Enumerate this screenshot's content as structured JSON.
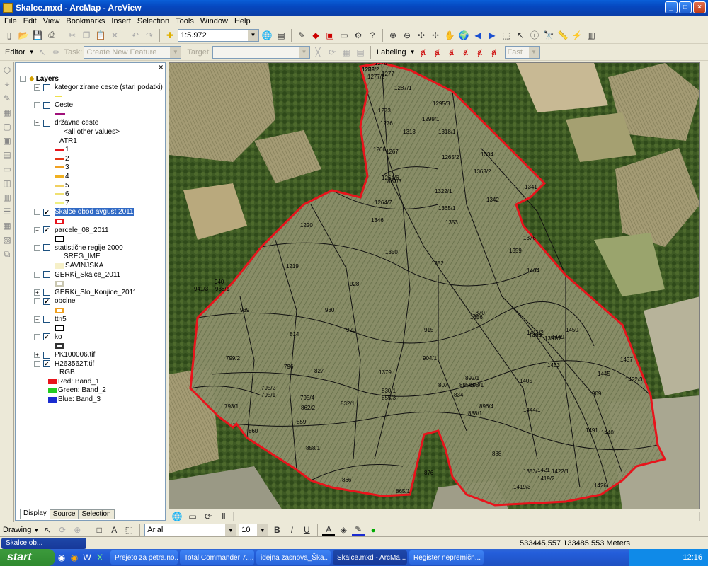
{
  "window": {
    "title": "Skalce.mxd - ArcMap - ArcView"
  },
  "menu": [
    "File",
    "Edit",
    "View",
    "Bookmarks",
    "Insert",
    "Selection",
    "Tools",
    "Window",
    "Help"
  ],
  "toolbar1": {
    "scale": "1:5.972"
  },
  "editor": {
    "label": "Editor",
    "task_label": "Task:",
    "task_value": "Create New Feature",
    "target_label": "Target:",
    "labeling_label": "Labeling",
    "fast_value": "Fast"
  },
  "toc": {
    "root": "Layers",
    "layers": [
      {
        "name": "kategorizirane ceste (stari podatki)",
        "checked": false
      },
      {
        "name": "Ceste",
        "checked": false
      },
      {
        "name": "državne ceste",
        "checked": false,
        "sub_all": "<all other values>",
        "sub_field": "ATR1",
        "classes": [
          "1",
          "2",
          "3",
          "4",
          "5",
          "6",
          "7"
        ]
      },
      {
        "name": "Skalce obod avgust 2011",
        "checked": true
      },
      {
        "name": "parcele_08_2011",
        "checked": true
      },
      {
        "name": "statistične regije 2000",
        "checked": false,
        "sub_field": "SREG_IME",
        "sub_value": "SAVINJSKA"
      },
      {
        "name": "GERKi_Skalce_2011",
        "checked": false
      },
      {
        "name": "GERKi_Slo_Konjice_2011",
        "checked": false
      },
      {
        "name": "obcine",
        "checked": true
      },
      {
        "name": "ttn5",
        "checked": false
      },
      {
        "name": "ko",
        "checked": true
      },
      {
        "name": "PK100006.tif",
        "checked": false
      },
      {
        "name": "H263562T.tif",
        "checked": true,
        "sub_field": "RGB",
        "bands": [
          "Red:   Band_1",
          "Green: Band_2",
          "Blue:  Band_3"
        ]
      }
    ],
    "tabs": [
      "Display",
      "Source",
      "Selection"
    ]
  },
  "map": {
    "parcels": [
      "1272",
      "1278",
      "1277/2",
      "1277",
      "1287/1",
      "1295/3",
      "1273",
      "1276",
      "1299/1",
      "1313",
      "1318/1",
      "1267",
      "1266",
      "1265/2",
      "1334",
      "1363/2",
      "1264/6",
      "1342",
      "1341",
      "1322/1",
      "1346",
      "1220",
      "1353",
      "1365/1",
      "1350",
      "1219",
      "1352",
      "1376",
      "1359",
      "1464",
      "928",
      "930",
      "939",
      "920",
      "915",
      "1370",
      "1356",
      "1454",
      "1450",
      "1449",
      "1445",
      "909",
      "1379",
      "1405",
      "1440",
      "1426",
      "1419/3",
      "1419/2",
      "1421",
      "1422/1",
      "888",
      "876",
      "866",
      "865/1",
      "858/1",
      "859",
      "860",
      "832/1",
      "796",
      "795/2",
      "795/1",
      "795/4",
      "793/1",
      "799/2",
      "827",
      "814",
      "1357/2",
      "1411/2",
      "1444/1",
      "1491",
      "1453",
      "1437",
      "1422/3",
      "1353/1",
      "940",
      "938/1",
      "941/3",
      "904/1",
      "892/1",
      "898/1",
      "896/4",
      "834",
      "830/1",
      "855/3",
      "807",
      "862/2",
      "888/1",
      "895/5",
      "867/3",
      "1264/7",
      "1285/2"
    ],
    "colors": {
      "boundary": "#e8141c",
      "outline": "#111111"
    }
  },
  "drawing": {
    "label": "Drawing",
    "font": "Arial",
    "size": "10",
    "bold": "B",
    "italic": "I",
    "underline": "U"
  },
  "status": {
    "coords": "533445,557  133485,553 Meters",
    "task_short": "Skalce ob..."
  },
  "taskbar": {
    "start": "start",
    "items": [
      "Prejeto za petra.no...",
      "Total Commander 7....",
      "idejna zasnova_Ška...",
      "Skalce.mxd - ArcMa...",
      "Register nepremičn..."
    ],
    "clock": "12:16"
  }
}
